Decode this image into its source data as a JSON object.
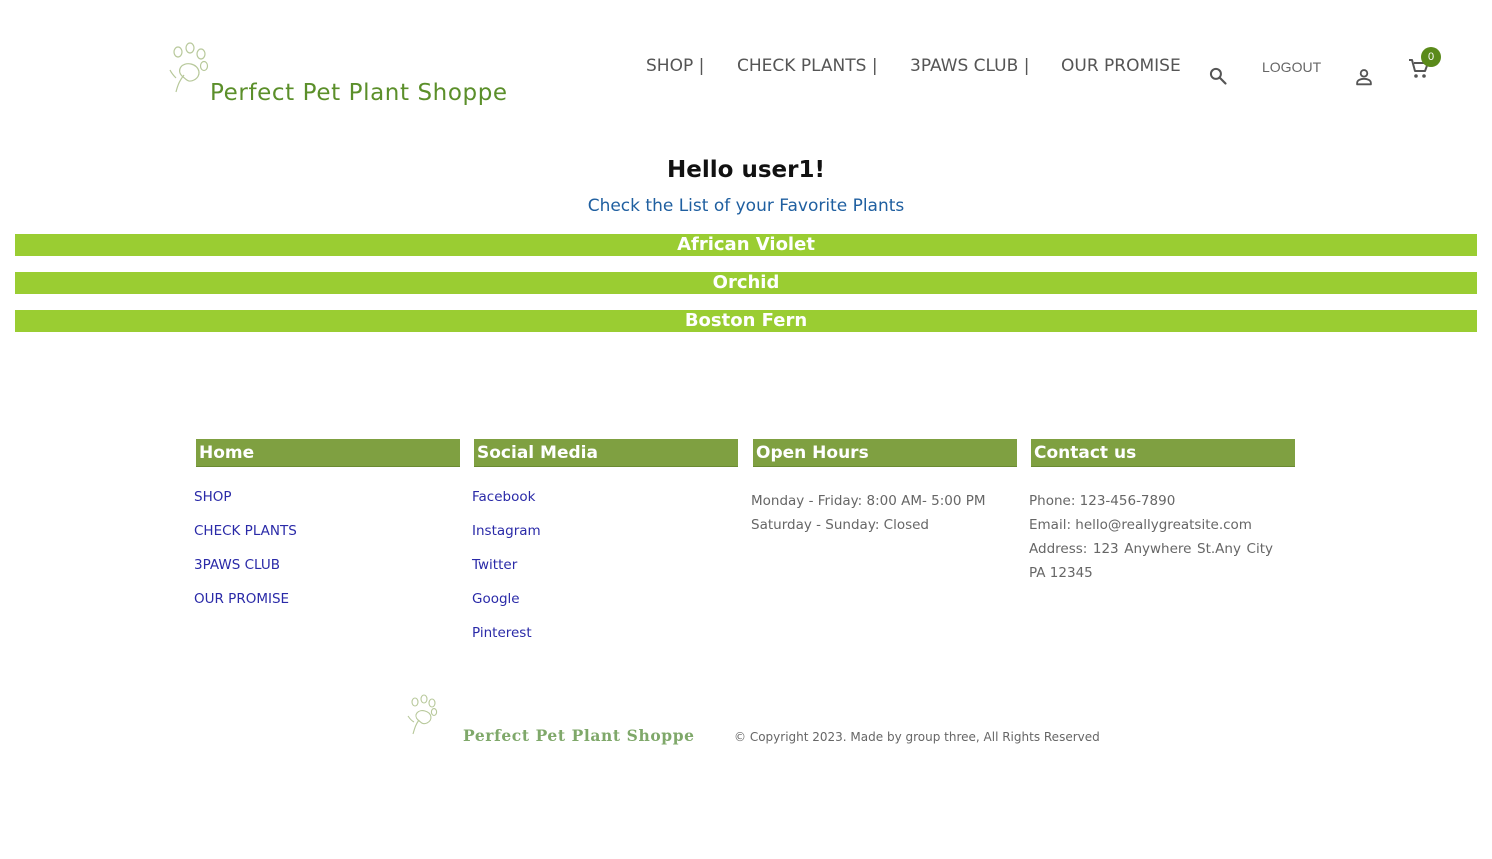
{
  "header": {
    "brand": "Perfect Pet Plant Shoppe",
    "nav": [
      "SHOP |",
      "CHECK PLANTS |",
      "3PAWS CLUB |",
      "OUR PROMISE"
    ],
    "logout_label": "LOGOUT",
    "cart_count": "0",
    "icons": [
      "paw-logo-icon",
      "search-icon",
      "user-icon",
      "cart-icon"
    ]
  },
  "main": {
    "greeting": "Hello user1!",
    "favorites_link": "Check the List of your Favorite Plants",
    "favorite_plants": [
      "African Violet",
      "Orchid",
      "Boston Fern"
    ]
  },
  "footer": {
    "home": {
      "title": "Home",
      "links": [
        "SHOP",
        "CHECK PLANTS",
        "3PAWS CLUB",
        "OUR PROMISE"
      ]
    },
    "social": {
      "title": "Social Media",
      "links": [
        "Facebook",
        "Instagram",
        "Twitter",
        "Google",
        "Pinterest"
      ]
    },
    "hours": {
      "title": "Open Hours",
      "weekday": "Monday - Friday: 8:00 AM- 5:00 PM",
      "weekend": "Saturday - Sunday: Closed"
    },
    "contact": {
      "title": "Contact us",
      "phone": "Phone: 123-456-7890",
      "email": "Email: hello@reallygreatsite.com",
      "address": "Address: 123 Anywhere St.Any City PA 12345"
    },
    "bottom_brand": "Perfect Pet Plant Shoppe",
    "copyright": "© Copyright 2023. Made by group three, All Rights Reserved"
  },
  "colors": {
    "brand_green": "#5b8f2a",
    "plant_bar": "#9acd32",
    "footer_header": "#7fa041",
    "link_blue": "#2a2aa8",
    "cart_badge": "#5a8a1a"
  }
}
